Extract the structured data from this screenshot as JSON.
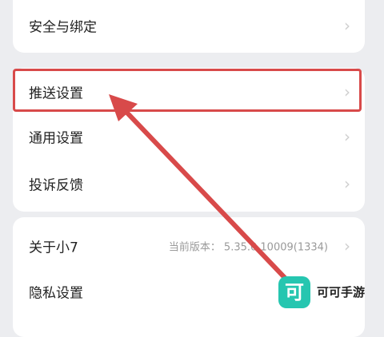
{
  "groups": [
    {
      "items": [
        {
          "label": "安全与绑定"
        }
      ]
    },
    {
      "items": [
        {
          "label": "推送设置",
          "highlighted": true
        },
        {
          "label": "通用设置"
        },
        {
          "label": "投诉反馈"
        }
      ]
    },
    {
      "items": [
        {
          "label": "关于小7",
          "version_label": "当前版本：",
          "version_value": "5.35.0.10009(1334)"
        },
        {
          "label": "隐私设置"
        }
      ]
    }
  ],
  "icons": {
    "chevron": "›"
  },
  "annotation": {
    "color": "#d84a4a"
  },
  "watermark": {
    "logo_char": "可",
    "text": "可可手游",
    "logo_color": "#26c6b0"
  }
}
